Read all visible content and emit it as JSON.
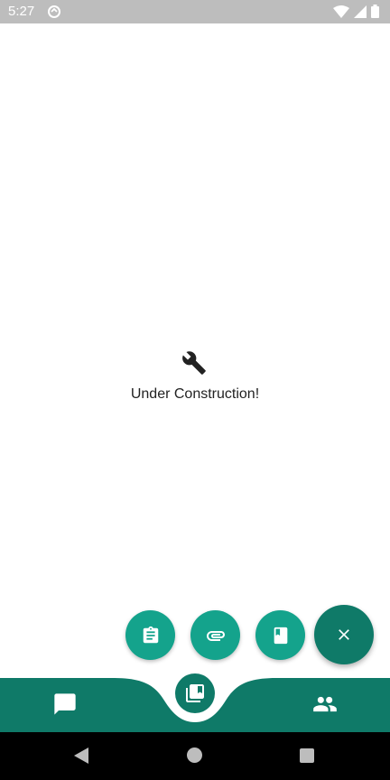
{
  "status_bar": {
    "time": "5:27",
    "icons": [
      "sync-icon",
      "wifi-icon",
      "signal-icon",
      "battery-icon"
    ]
  },
  "main": {
    "icon": "wrench-icon",
    "message": "Under Construction!"
  },
  "fab_menu": {
    "actions": [
      {
        "icon": "clipboard-icon"
      },
      {
        "icon": "paperclip-icon"
      },
      {
        "icon": "book-icon"
      }
    ],
    "main_icon": "close-icon"
  },
  "bottom_nav": {
    "items": [
      {
        "icon": "chat-icon"
      },
      {
        "icon": "library-books-icon"
      },
      {
        "icon": "people-icon"
      }
    ]
  },
  "system_nav": {
    "buttons": [
      "back-icon",
      "home-icon",
      "recents-icon"
    ]
  },
  "colors": {
    "primary": "#0f7a68",
    "accent": "#14a38c",
    "status_bar": "#bdbdbd"
  }
}
